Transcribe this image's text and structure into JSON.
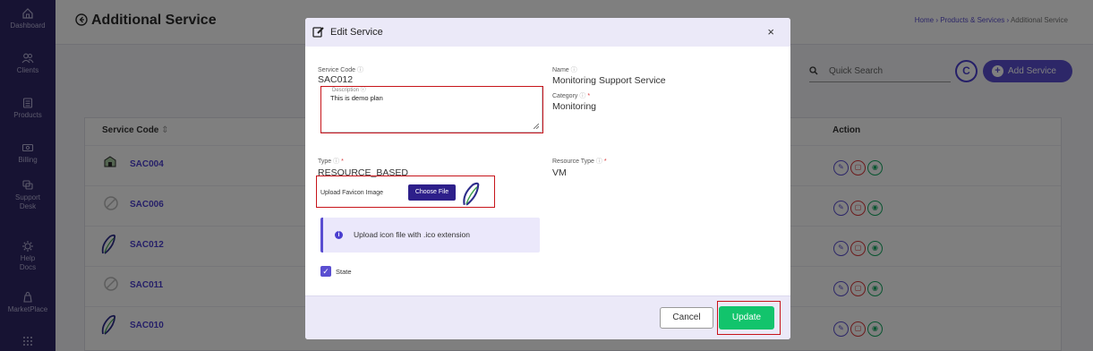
{
  "sidebar": {
    "items": [
      {
        "label": "Dashboard",
        "icon": "home-icon"
      },
      {
        "label": "Clients",
        "icon": "users-icon"
      },
      {
        "label": "Products",
        "icon": "products-icon"
      },
      {
        "label": "Billing",
        "icon": "billing-icon"
      },
      {
        "label": "Support\nDesk",
        "label_line1": "Support",
        "label_line2": "Desk",
        "icon": "support-icon"
      },
      {
        "label_line1": "Help",
        "label_line2": "Docs",
        "icon": "help-icon"
      },
      {
        "label": "MarketPlace",
        "icon": "marketplace-icon"
      }
    ]
  },
  "header": {
    "title": "Additional Service",
    "breadcrumb": [
      "Home",
      "Products & Services",
      "Additional Service"
    ]
  },
  "toolbar": {
    "search_placeholder": "Quick Search",
    "add_label": "Add Service"
  },
  "table": {
    "columns": [
      "Service Code",
      "Action"
    ],
    "rows": [
      {
        "code": "SAC004",
        "icon": "shield-favicon-icon"
      },
      {
        "code": "SAC006",
        "icon": "placeholder-image-icon"
      },
      {
        "code": "SAC012",
        "icon": "leaf-favicon-icon"
      },
      {
        "code": "SAC011",
        "icon": "placeholder-image-icon"
      },
      {
        "code": "SAC010",
        "icon": "leaf-favicon-icon"
      }
    ]
  },
  "modal": {
    "title": "Edit Service",
    "close": "×",
    "service_code_label": "Service Code",
    "service_code_value": "SAC012",
    "name_label": "Name",
    "name_value": "Monitoring Support Service",
    "description_label": "Description",
    "description_value": "This is demo plan",
    "category_label": "Category",
    "category_value": "Monitoring",
    "type_label": "Type",
    "type_value": "RESOURCE_BASED",
    "resource_type_label": "Resource Type",
    "resource_type_value": "VM",
    "upload_label": "Upload Favicon Image",
    "choose_file_label": "Choose File",
    "info_text": "Upload icon file with .ico extension",
    "state_label": "State",
    "state_checked": true,
    "cancel_label": "Cancel",
    "update_label": "Update"
  },
  "colors": {
    "sidebar": "#2e2766",
    "accent": "#5a4ed1",
    "update": "#12c46c",
    "highlight_box": "#c7141a"
  }
}
